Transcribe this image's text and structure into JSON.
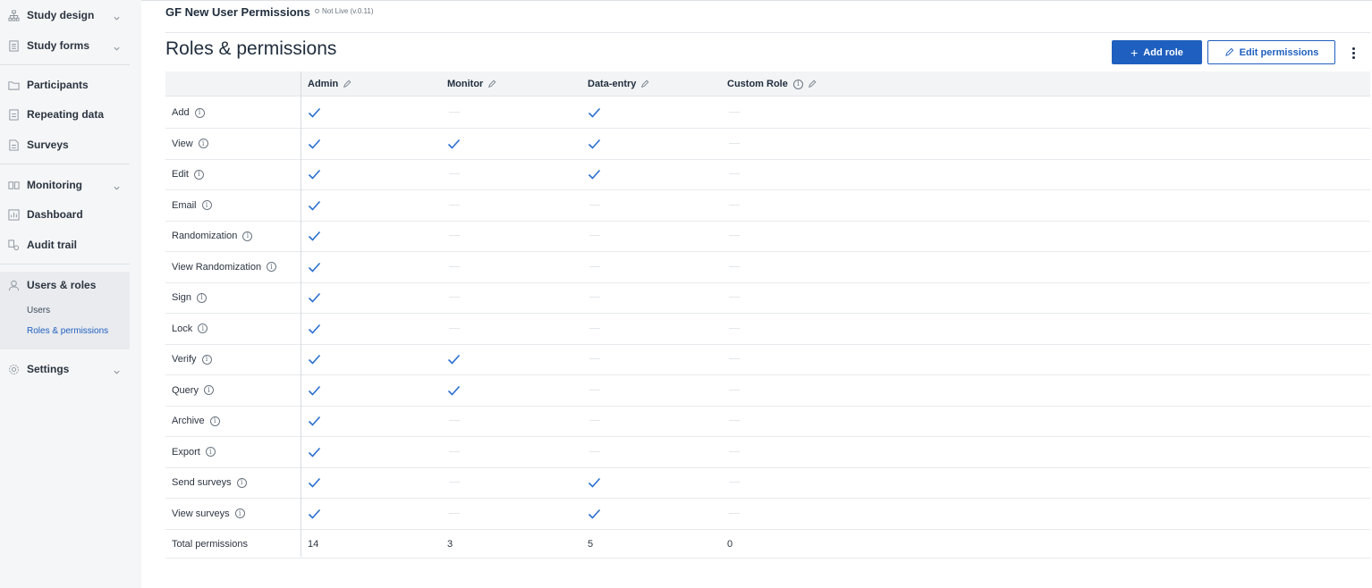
{
  "sidebar": {
    "items": [
      {
        "label": "Study design",
        "icon": "hierarchy-icon",
        "chevron": true
      },
      {
        "label": "Study forms",
        "icon": "form-icon",
        "chevron": true
      },
      {
        "label": "Participants",
        "icon": "folder-icon",
        "chevron": false
      },
      {
        "label": "Repeating data",
        "icon": "document-icon",
        "chevron": false
      },
      {
        "label": "Surveys",
        "icon": "survey-icon",
        "chevron": false
      },
      {
        "label": "Monitoring",
        "icon": "monitoring-icon",
        "chevron": true
      },
      {
        "label": "Dashboard",
        "icon": "dashboard-icon",
        "chevron": false
      },
      {
        "label": "Audit trail",
        "icon": "audit-icon",
        "chevron": false
      },
      {
        "label": "Users & roles",
        "icon": "user-icon",
        "chevron": false
      },
      {
        "label": "Settings",
        "icon": "gear-icon",
        "chevron": true
      }
    ],
    "sub_items": [
      {
        "label": "Users",
        "active": false
      },
      {
        "label": "Roles & permissions",
        "active": true
      }
    ]
  },
  "header": {
    "app_title": "GF New User Permissions",
    "status": "Not Live (v.0.11)",
    "page_title": "Roles & permissions",
    "add_role_label": "Add role",
    "edit_permissions_label": "Edit permissions"
  },
  "colors": {
    "accent": "#1f5fbf",
    "check": "#2a6fcf"
  },
  "table": {
    "columns": [
      {
        "label": "Admin",
        "editable": true,
        "info": false
      },
      {
        "label": "Monitor",
        "editable": true,
        "info": false
      },
      {
        "label": "Data-entry",
        "editable": true,
        "info": false
      },
      {
        "label": "Custom Role",
        "editable": true,
        "info": true
      }
    ],
    "rows": [
      {
        "label": "Add",
        "values": [
          true,
          false,
          true,
          false
        ]
      },
      {
        "label": "View",
        "values": [
          true,
          true,
          true,
          false
        ]
      },
      {
        "label": "Edit",
        "values": [
          true,
          false,
          true,
          false
        ]
      },
      {
        "label": "Email",
        "values": [
          true,
          false,
          false,
          false
        ]
      },
      {
        "label": "Randomization",
        "values": [
          true,
          false,
          false,
          false
        ]
      },
      {
        "label": "View Randomization",
        "values": [
          true,
          false,
          false,
          false
        ]
      },
      {
        "label": "Sign",
        "values": [
          true,
          false,
          false,
          false
        ]
      },
      {
        "label": "Lock",
        "values": [
          true,
          false,
          false,
          false
        ]
      },
      {
        "label": "Verify",
        "values": [
          true,
          true,
          false,
          false
        ]
      },
      {
        "label": "Query",
        "values": [
          true,
          true,
          false,
          false
        ]
      },
      {
        "label": "Archive",
        "values": [
          true,
          false,
          false,
          false
        ]
      },
      {
        "label": "Export",
        "values": [
          true,
          false,
          false,
          false
        ]
      },
      {
        "label": "Send surveys",
        "values": [
          true,
          false,
          true,
          false
        ]
      },
      {
        "label": "View surveys",
        "values": [
          true,
          false,
          true,
          false
        ]
      }
    ],
    "total_label": "Total permissions",
    "totals": [
      "14",
      "3",
      "5",
      "0"
    ]
  }
}
